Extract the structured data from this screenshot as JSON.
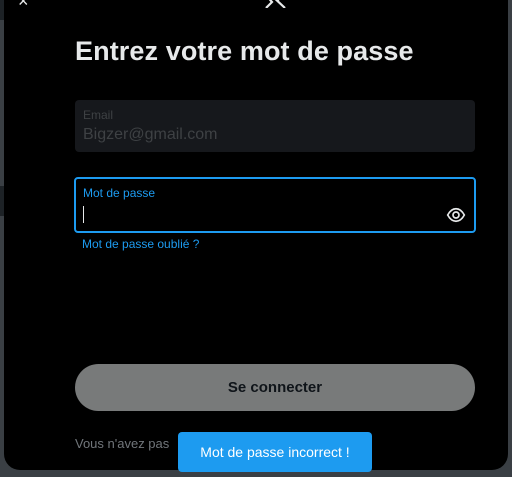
{
  "dialog": {
    "close_glyph": "×",
    "logo_icon": "x-logo-icon",
    "title": "Entrez votre mot de passe"
  },
  "email_field": {
    "label": "Email",
    "value": "Bigzer@gmail.com"
  },
  "password_field": {
    "label": "Mot de passe",
    "value": "",
    "reveal_icon": "eye-icon"
  },
  "forgot_link": "Mot de passe oublié ?",
  "login_button": "Se connecter",
  "signup_prompt": "Vous n'avez pas",
  "toast": {
    "message": "Mot de passe incorrect !"
  },
  "colors": {
    "accent": "#1d9bf0",
    "background": "#000000",
    "button_disabled": "#787a7a",
    "toast_bg": "#1d9bf0"
  }
}
